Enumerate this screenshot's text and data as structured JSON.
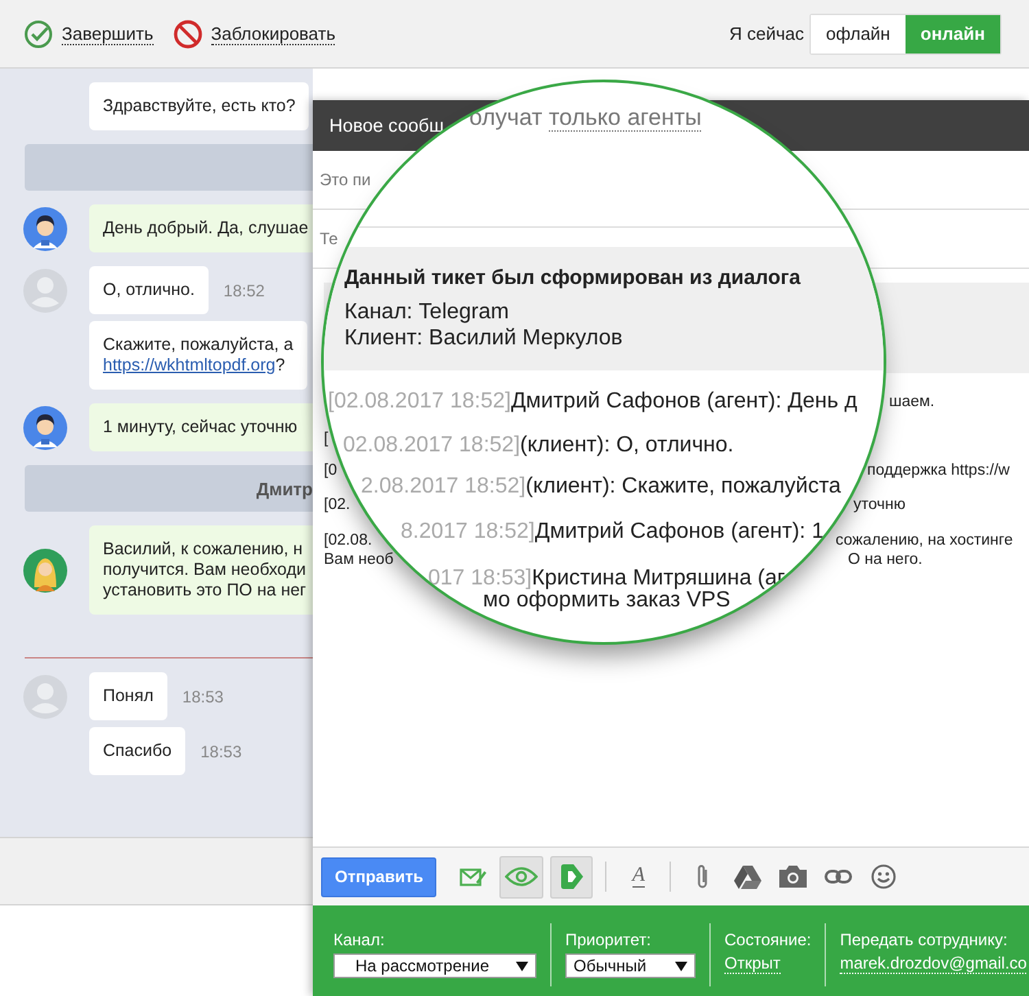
{
  "topbar": {
    "actions": [
      {
        "kind": "finish",
        "label": "Завершить"
      },
      {
        "kind": "block",
        "label": "Заблокировать"
      }
    ],
    "status_label": "Я сейчас",
    "status_options": [
      {
        "label": "офлайн",
        "selected": false
      },
      {
        "label": "онлайн",
        "selected": true
      }
    ]
  },
  "chat": [
    {
      "kind": "client",
      "lines": [
        [
          {
            "text": "Здравствуйте, есть кто?"
          }
        ]
      ]
    },
    {
      "kind": "system"
    },
    {
      "kind": "agent",
      "avatar": {
        "kind": "male"
      },
      "lines": [
        [
          {
            "text": "День добрый. Да, слушае"
          }
        ]
      ]
    },
    {
      "kind": "client",
      "avatar": {
        "kind": "guest"
      },
      "lines": [
        [
          {
            "text": "О, отлично."
          }
        ]
      ],
      "time": "18:52"
    },
    {
      "kind": "client",
      "lines": [
        [
          {
            "text": "Скажите, пожалуйста, а"
          }
        ],
        [
          {
            "kind": "link",
            "text": "https://wkhtmltopdf.org"
          },
          {
            "text": "?"
          }
        ]
      ]
    },
    {
      "kind": "agent",
      "avatar": {
        "kind": "male"
      },
      "lines": [
        [
          {
            "text": "1 минуту, сейчас уточню"
          }
        ]
      ]
    },
    {
      "kind": "system",
      "text": "Дмитр"
    },
    {
      "kind": "agent",
      "avatar": {
        "kind": "female"
      },
      "lines": [
        [
          {
            "text": "Василий, к сожалению, н"
          }
        ],
        [
          {
            "text": "получится. Вам необходи"
          }
        ],
        [
          {
            "text": "установить это ПО на нег"
          }
        ]
      ]
    },
    {
      "kind": "divider"
    },
    {
      "kind": "client",
      "avatar": {
        "kind": "guest"
      },
      "lines": [
        [
          {
            "text": "Понял"
          }
        ]
      ],
      "time": "18:53"
    },
    {
      "kind": "client",
      "lines": [
        [
          {
            "text": "Спасибо"
          }
        ]
      ],
      "time": "18:53"
    }
  ],
  "compose": {
    "title": "Новое сообщ",
    "fields": [
      {
        "placeholder": "Это пи"
      },
      {
        "placeholder": "Те"
      }
    ],
    "log_fragments": [
      {
        "right": "шаем."
      },
      {
        "left": "["
      },
      {
        "left": "[0",
        "right": "поддержка https://w"
      },
      {
        "left": "[02.",
        "right": "уточню"
      },
      {
        "left": "[02.08.",
        "right": "сожалению, на хостинге"
      },
      {
        "left": "Вам необ",
        "right": "О на него."
      }
    ],
    "send": "Отправить",
    "tools": [
      {
        "kind": "template",
        "on": false
      },
      {
        "kind": "eye",
        "on": true
      },
      {
        "kind": "tag",
        "on": true
      },
      {
        "kind": "font",
        "glyph": "A",
        "on": false
      },
      {
        "kind": "attach",
        "on": false
      },
      {
        "kind": "drive",
        "on": false
      },
      {
        "kind": "camera",
        "on": false
      },
      {
        "kind": "link",
        "on": false
      },
      {
        "kind": "emoji",
        "on": false
      }
    ],
    "properties": [
      {
        "kind": "select",
        "label": "Канал:",
        "value": "На рассмотрение"
      },
      {
        "kind": "select",
        "label": "Приоритет:",
        "value": "Обычный"
      },
      {
        "kind": "link",
        "label": "Состояние:",
        "value": "Открыт"
      },
      {
        "kind": "link",
        "label": "Передать сотруднику:",
        "value": "marek.drozdov@gmail.co"
      }
    ]
  },
  "magnifier": {
    "header_text": "олучат",
    "header_link": "только агенты",
    "ticket": {
      "title": "Данный тикет был сформирован из диалога",
      "lines": [
        "Канал: Telegram",
        "Клиент: Василий Меркулов"
      ]
    },
    "log": [
      {
        "time": "[02.08.2017 18:52]",
        "text": "Дмитрий Сафонов (агент): День д"
      },
      {
        "time": "02.08.2017 18:52]",
        "text": "(клиент): О, отлично."
      },
      {
        "time": "2.08.2017 18:52]",
        "text": "(клиент): Скажите, пожалуйста"
      },
      {
        "time": "8.2017 18:52]",
        "text": "Дмитрий Сафонов (агент): 1"
      },
      {
        "time": "017 18:53]",
        "text": "Кристина Митряшина (аг"
      },
      {
        "text": "мо оформить заказ VPS"
      }
    ]
  }
}
